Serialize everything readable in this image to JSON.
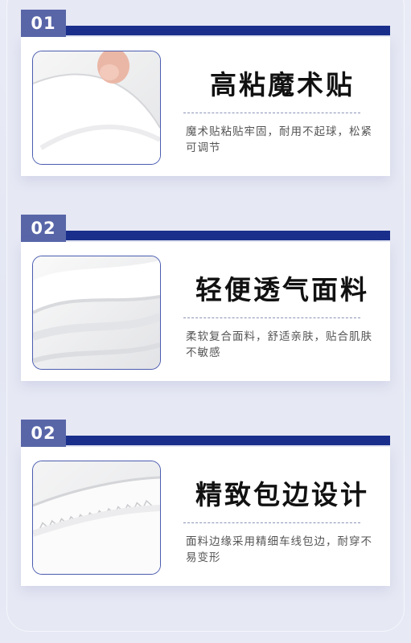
{
  "sections": [
    {
      "number": "01",
      "title": "高粘魔术贴",
      "description": "魔术贴粘贴牢固，耐用不起球，松紧可调节",
      "image": "velcro-closeup-with-finger"
    },
    {
      "number": "02",
      "title": "轻便透气面料",
      "description": "柔软复合面料，舒适亲肤，贴合肌肤不敏感",
      "image": "soft-white-fabric-folds"
    },
    {
      "number": "02",
      "title": "精致包边设计",
      "description": "面料边缘采用精细车线包边，耐穿不易变形",
      "image": "stitched-edge-closeup"
    }
  ],
  "colors": {
    "accent_navy": "#1a2f8b",
    "tab_blue": "#5866a8",
    "thumb_border": "#4a5cb0",
    "background": "#e6e8f4"
  }
}
